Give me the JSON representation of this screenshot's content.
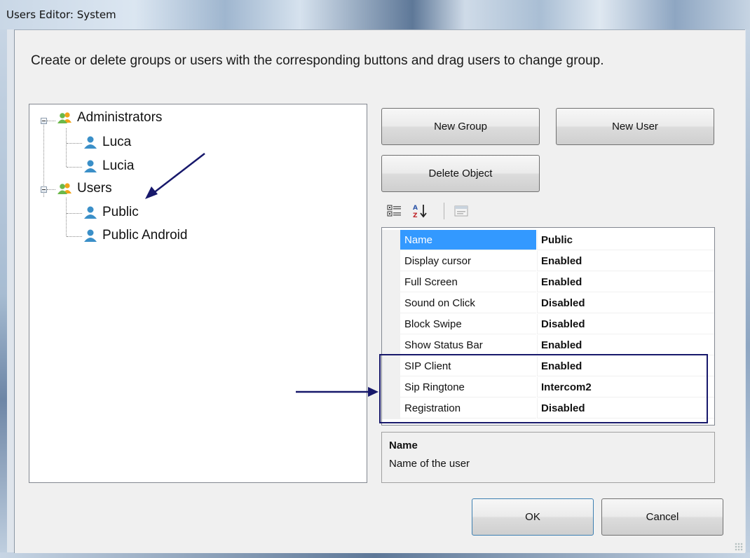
{
  "window": {
    "title": "Users Editor: System"
  },
  "instructions": "Create or delete groups or users with the corresponding buttons and drag users to change group.",
  "tree": {
    "groups": [
      {
        "label": "Administrators",
        "users": [
          "Luca",
          "Lucia"
        ]
      },
      {
        "label": "Users",
        "users": [
          "Public",
          "Public Android"
        ]
      }
    ]
  },
  "buttons": {
    "new_group": "New Group",
    "new_user": "New User",
    "delete_object": "Delete Object",
    "ok": "OK",
    "cancel": "Cancel"
  },
  "toolbar": {
    "icons": [
      "categorized-icon",
      "alphabetical-sort-icon",
      "property-pages-icon"
    ]
  },
  "properties": [
    {
      "name": "Name",
      "value": "Public",
      "selected": true
    },
    {
      "name": "Display cursor",
      "value": "Enabled"
    },
    {
      "name": "Full Screen",
      "value": "Enabled"
    },
    {
      "name": "Sound on Click",
      "value": "Disabled"
    },
    {
      "name": "Block Swipe",
      "value": "Disabled"
    },
    {
      "name": "Show Status Bar",
      "value": "Enabled"
    },
    {
      "name": "SIP Client",
      "value": "Enabled"
    },
    {
      "name": "Sip Ringtone",
      "value": "Intercom2"
    },
    {
      "name": "Registration",
      "value": "Disabled"
    }
  ],
  "help": {
    "title": "Name",
    "description": "Name of the user"
  },
  "colors": {
    "selection": "#3399ff",
    "annotation": "#17186b"
  }
}
